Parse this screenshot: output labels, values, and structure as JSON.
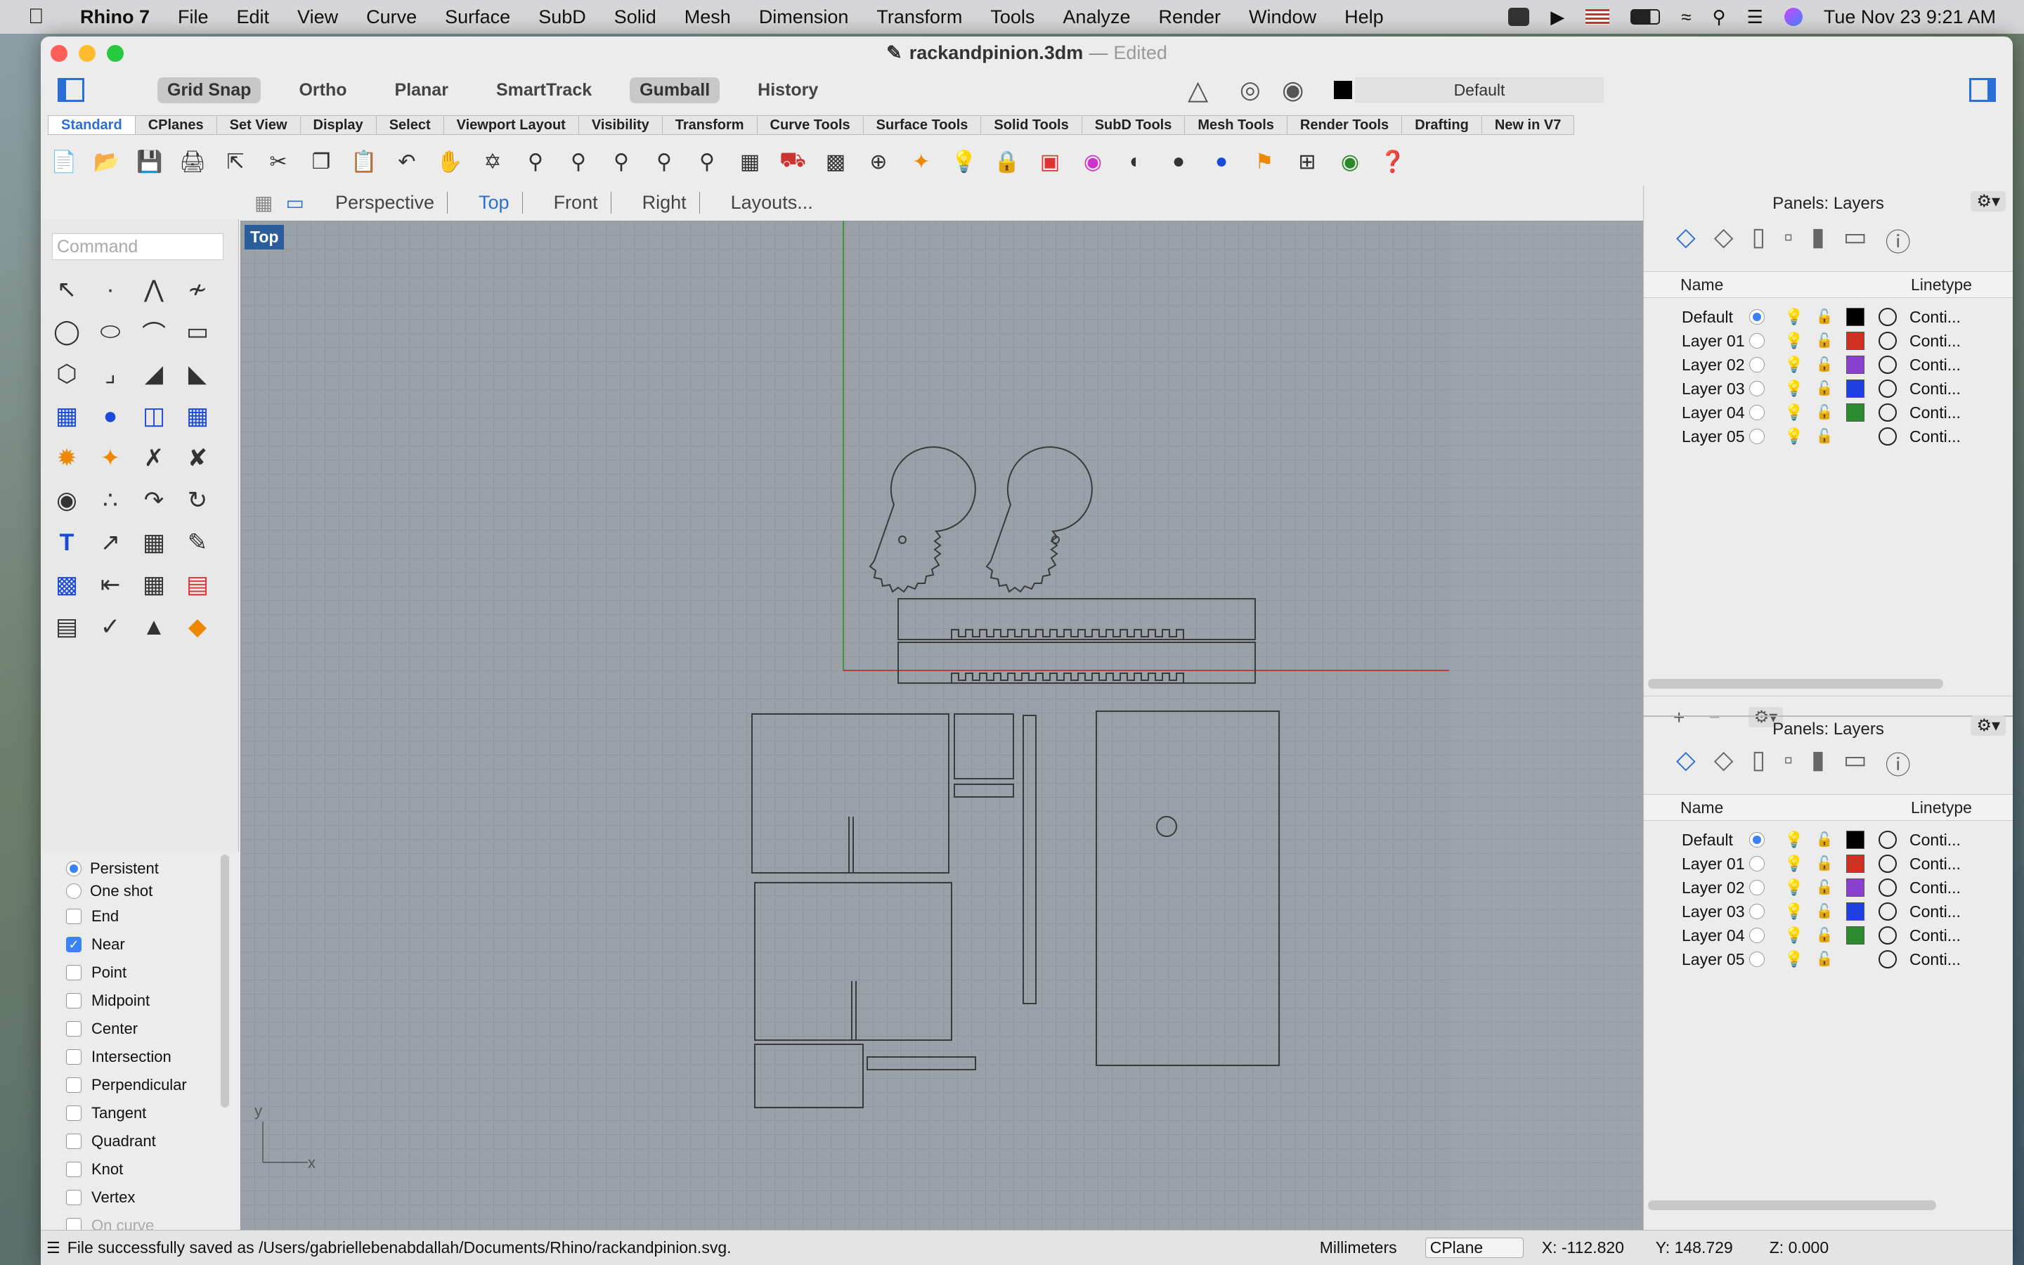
{
  "menubar": {
    "app": "Rhino 7",
    "items": [
      "File",
      "Edit",
      "View",
      "Curve",
      "Surface",
      "SubD",
      "Solid",
      "Mesh",
      "Dimension",
      "Transform",
      "Tools",
      "Analyze",
      "Render",
      "Window",
      "Help"
    ],
    "clock": "Tue Nov 23  9:21 AM"
  },
  "window": {
    "file": "rackandpinion.3dm",
    "sep": "—",
    "state": "Edited"
  },
  "toggles": [
    "Grid Snap",
    "Ortho",
    "Planar",
    "SmartTrack",
    "Gumball",
    "History"
  ],
  "layer_current": "Default",
  "tabs": [
    "Standard",
    "CPlanes",
    "Set View",
    "Display",
    "Select",
    "Viewport Layout",
    "Visibility",
    "Transform",
    "Curve Tools",
    "Surface Tools",
    "Solid Tools",
    "SubD Tools",
    "Mesh Tools",
    "Render Tools",
    "Drafting",
    "New in V7"
  ],
  "command_placeholder": "Command",
  "viewtabs": [
    "Perspective",
    "Top",
    "Front",
    "Right",
    "Layouts..."
  ],
  "viewport_label": "Top",
  "osnap": {
    "persistent": "Persistent",
    "oneshot": "One shot",
    "items": [
      {
        "l": "End",
        "c": false
      },
      {
        "l": "Near",
        "c": true
      },
      {
        "l": "Point",
        "c": false
      },
      {
        "l": "Midpoint",
        "c": false
      },
      {
        "l": "Center",
        "c": false
      },
      {
        "l": "Intersection",
        "c": false
      },
      {
        "l": "Perpendicular",
        "c": false
      },
      {
        "l": "Tangent",
        "c": false
      },
      {
        "l": "Quadrant",
        "c": false
      },
      {
        "l": "Knot",
        "c": false
      },
      {
        "l": "Vertex",
        "c": false
      },
      {
        "l": "On curve",
        "c": false
      }
    ]
  },
  "panel": {
    "title": "Panels: Layers",
    "col_name": "Name",
    "col_lt": "Linetype",
    "layers": [
      {
        "name": "Default",
        "color": "#000000",
        "lt": "Conti..."
      },
      {
        "name": "Layer 01",
        "color": "#d03020",
        "lt": "Conti..."
      },
      {
        "name": "Layer 02",
        "color": "#8a3fd0",
        "lt": "Conti..."
      },
      {
        "name": "Layer 03",
        "color": "#1f3fe0",
        "lt": "Conti..."
      },
      {
        "name": "Layer 04",
        "color": "#2e8a2e",
        "lt": "Conti..."
      },
      {
        "name": "Layer 05",
        "color": "",
        "lt": "Conti..."
      }
    ]
  },
  "status": {
    "msg": "File successfully saved as /Users/gabriellebenabdallah/Documents/Rhino/rackandpinion.svg.",
    "units": "Millimeters",
    "cplane": "CPlane",
    "x": "X: -112.820",
    "y": "Y: 148.729",
    "z": "Z: 0.000"
  }
}
